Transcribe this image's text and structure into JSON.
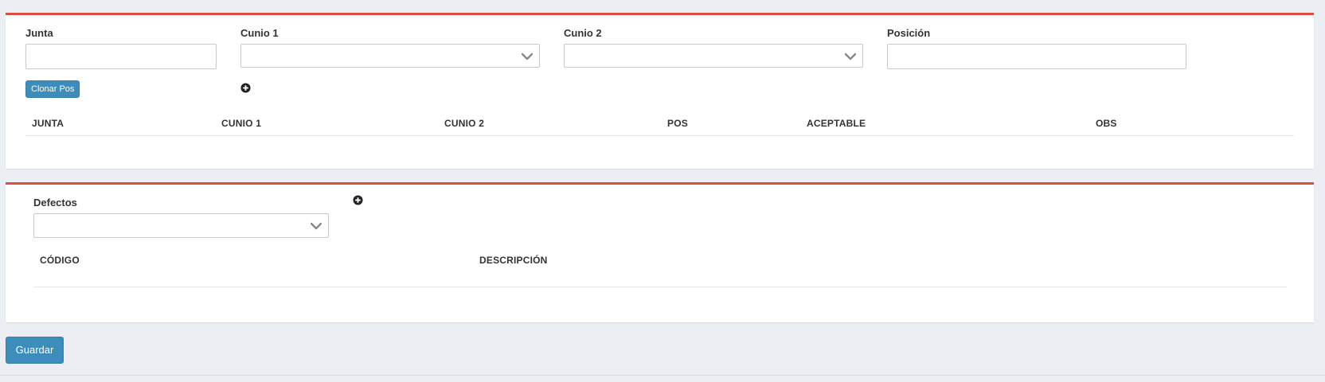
{
  "position_form": {
    "junta_label": "Junta",
    "junta_value": "",
    "cunio1_label": "Cunio 1",
    "cunio1_value": "",
    "cunio2_label": "Cunio 2",
    "cunio2_value": "",
    "posicion_label": "Posición",
    "posicion_value": "",
    "clone_button_label": "Clonar Pos",
    "add_icon": "plus-circle-icon"
  },
  "positions_table": {
    "columns": [
      "JUNTA",
      "CUNIO 1",
      "CUNIO 2",
      "POS",
      "ACEPTABLE",
      "OBS"
    ],
    "rows": []
  },
  "defects_form": {
    "defectos_label": "Defectos",
    "defectos_value": "",
    "add_icon": "plus-circle-icon"
  },
  "defects_table": {
    "columns": [
      "CÓDIGO",
      "DESCRIPCIÓN"
    ],
    "rows": []
  },
  "actions": {
    "save_label": "Guardar"
  },
  "colors": {
    "panel_accent": "#d9503f",
    "primary_button": "#3c8dbc",
    "page_background": "#ebeef3"
  }
}
